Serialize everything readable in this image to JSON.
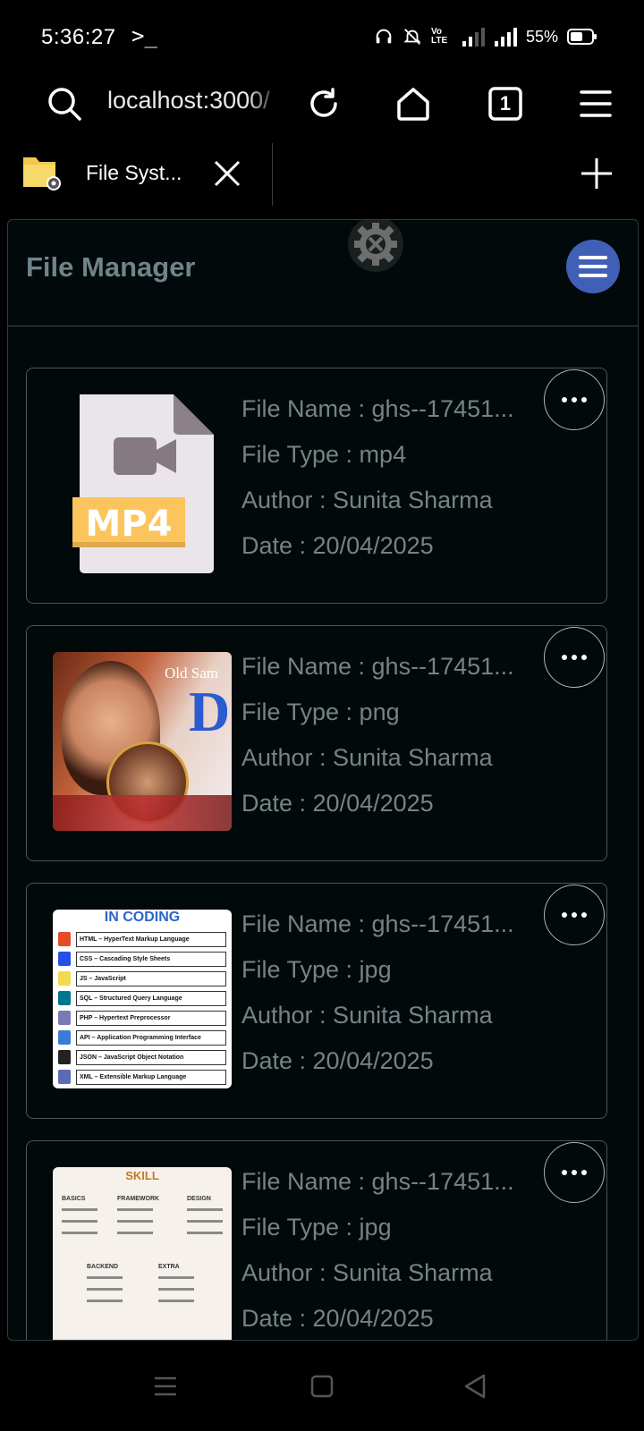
{
  "status": {
    "time": "5:36:27",
    "terminal": ">_",
    "volte": "Vo\nLTE",
    "battery": "55%"
  },
  "browser": {
    "url": "localhost:3000/",
    "tab_count": "1",
    "tab_title": "File Syst..."
  },
  "app": {
    "title": "File Manager"
  },
  "files": [
    {
      "name": "File Name : ghs--17451...",
      "type": "File Type : mp4",
      "author": "Author : Sunita Sharma",
      "date": "Date : 20/04/2025",
      "badge": "MP4"
    },
    {
      "name": "File Name : ghs--17451...",
      "type": "File Type : png",
      "author": "Author : Sunita Sharma",
      "date": "Date : 20/04/2025",
      "overlay": "Old Sam"
    },
    {
      "name": "File Name : ghs--17451...",
      "type": "File Type : jpg",
      "author": "Author : Sunita Sharma",
      "date": "Date : 20/04/2025",
      "heading": "IN CODING",
      "rows": [
        "HTML – HyperText Markup Language",
        "CSS – Cascading Style Sheets",
        "JS – JavaScript",
        "SQL – Structured Query Language",
        "PHP – Hypertext Preprocessor",
        "API – Application Programming Interface",
        "JSON – JavaScript Object Notation",
        "XML – Extensible Markup Language"
      ]
    },
    {
      "name": "File Name : ghs--17451...",
      "type": "File Type : jpg",
      "author": "Author : Sunita Sharma",
      "date": "Date : 20/04/2025",
      "heading": "SKILL",
      "columns": [
        "BASICS",
        "FRAMEWORK",
        "DESIGN",
        "BACKEND",
        "EXTRA"
      ]
    }
  ]
}
